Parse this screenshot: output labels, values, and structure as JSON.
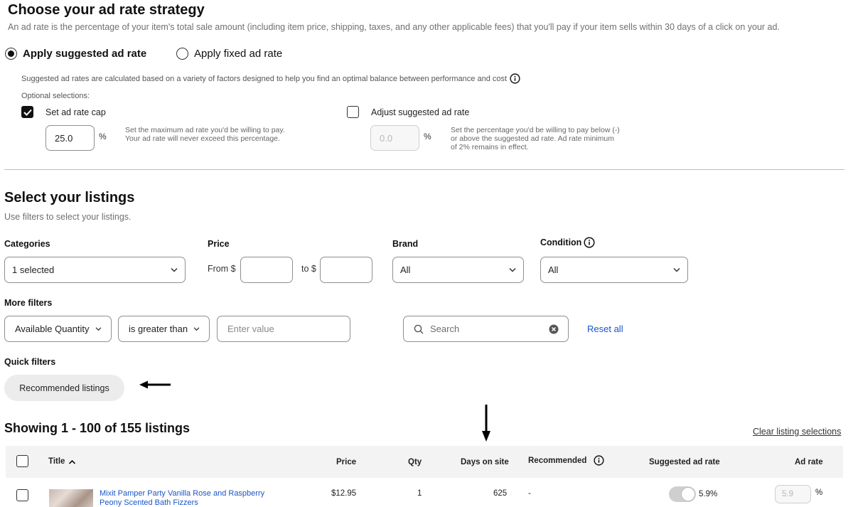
{
  "strategy": {
    "title": "Choose your ad rate strategy",
    "description": "An ad rate is the percentage of your item's total sale amount (including item price, shipping, taxes, and any other applicable fees) that you'll pay if your item sells within 30 days of a click on your ad.",
    "option_suggested": "Apply suggested ad rate",
    "option_fixed": "Apply fixed ad rate",
    "suggested_note": "Suggested ad rates are calculated based on a variety of factors designed to help you find an optimal balance between performance and cost",
    "optional_label": "Optional selections:",
    "cap_label": "Set ad rate cap",
    "cap_value": "25.0",
    "percent": "%",
    "cap_help_1": "Set the maximum ad rate you'd be willing to pay.",
    "cap_help_2": "Your ad rate will never exceed this percentage.",
    "adjust_label": "Adjust suggested ad rate",
    "adjust_value": "0.0",
    "adjust_help_1": "Set the percentage you'd be willing to pay below (-)",
    "adjust_help_2": "or above the suggested ad rate. Ad rate minimum",
    "adjust_help_3": "of 2% remains in effect."
  },
  "listings": {
    "title": "Select your listings",
    "subtitle": "Use filters to select your listings.",
    "categories_label": "Categories",
    "categories_value": "1 selected",
    "price_label": "Price",
    "from_label": "From $",
    "to_label": "to $",
    "brand_label": "Brand",
    "brand_value": "All",
    "condition_label": "Condition",
    "condition_value": "All",
    "more_filters_label": "More filters",
    "filter_field": "Available Quantity",
    "filter_operator": "is greater than",
    "filter_value_placeholder": "Enter value",
    "search_placeholder": "Search",
    "reset_all": "Reset all",
    "quick_filters_label": "Quick filters",
    "quick_filter_recommended": "Recommended listings"
  },
  "results": {
    "showing": "Showing 1 - 100 of 155 listings",
    "clear_selections": "Clear listing selections",
    "columns": {
      "title": "Title",
      "price": "Price",
      "qty": "Qty",
      "days": "Days on site",
      "recommended": "Recommended",
      "suggested": "Suggested ad rate",
      "ad_rate": "Ad rate"
    },
    "rows": [
      {
        "title_line1": "Mixit Pamper Party Vanilla Rose and Raspberry",
        "title_line2": "Peony Scented Bath Fizzers",
        "price": "$12.95",
        "qty": "1",
        "days": "625",
        "recommended": "-",
        "suggested_rate": "5.9%",
        "ad_rate": "5.9",
        "percent": "%"
      }
    ]
  },
  "colors": {
    "link": "#1a55c9",
    "text": "#111111",
    "muted": "#707070"
  }
}
